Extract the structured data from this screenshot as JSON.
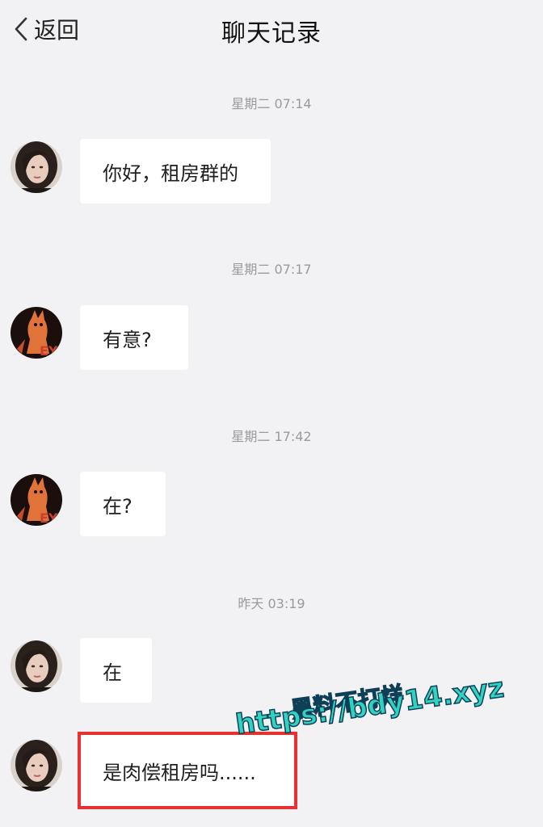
{
  "header": {
    "back_label": "返回",
    "title": "聊天记录"
  },
  "messages": [
    {
      "time": "星期二 07:14",
      "text": "你好，租房群的",
      "avatar": "woman-avatar"
    },
    {
      "time": "星期二 07:17",
      "text": "有意?",
      "avatar": "fox-avatar"
    },
    {
      "time": "星期二 17:42",
      "text": "在?",
      "avatar": "fox-avatar"
    },
    {
      "time": "昨天 03:19",
      "text": "在",
      "avatar": "woman-avatar"
    },
    {
      "time": "",
      "text": "是肉偿租房吗......",
      "avatar": "woman-avatar",
      "highlighted": true
    }
  ],
  "watermark": {
    "line1": "黑料不打烊",
    "line2": "https://bdy14.xyz"
  },
  "colors": {
    "background": "#f2f2f4",
    "bubble": "#ffffff",
    "highlight_border": "#e8322f",
    "watermark_fill": "#30d3c0"
  }
}
